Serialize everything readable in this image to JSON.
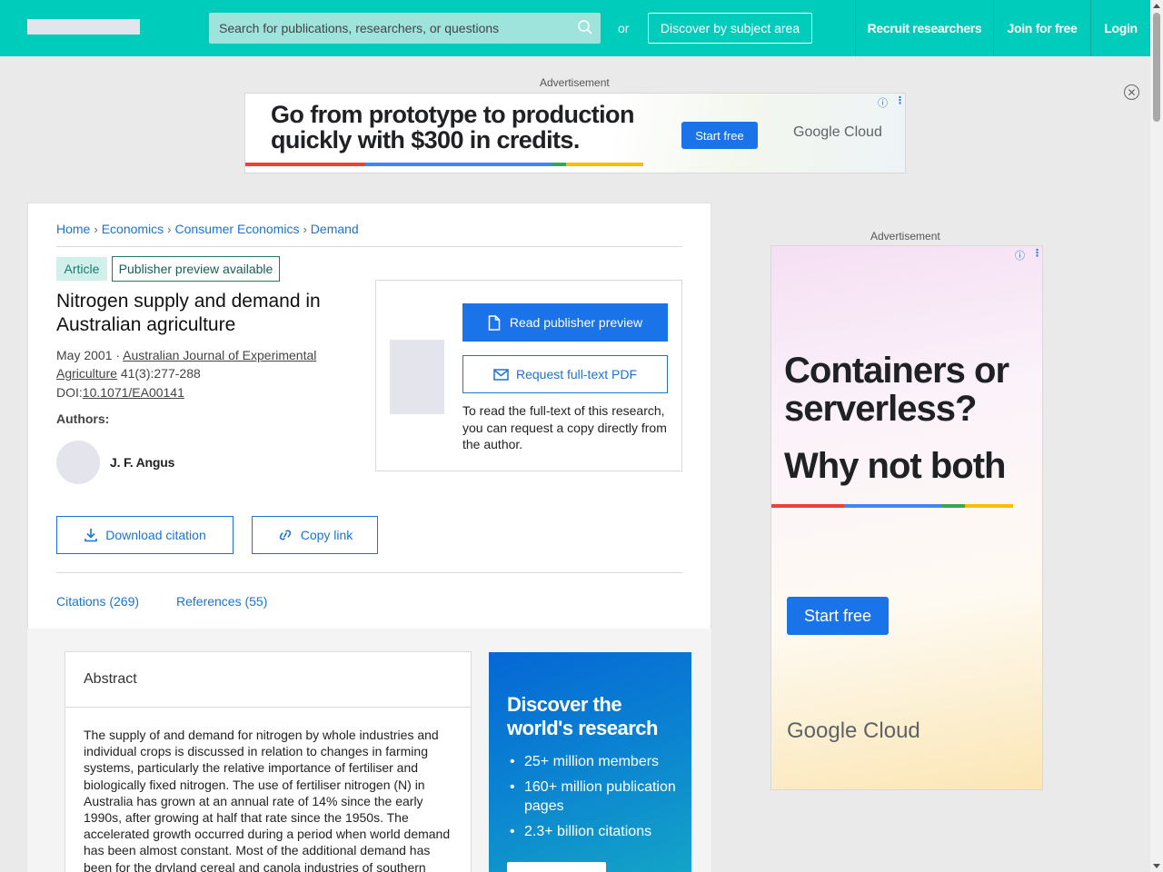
{
  "header": {
    "search_placeholder": "Search for publications, researchers, or questions",
    "or_text": "or",
    "discover_label": "Discover by subject area",
    "nav": [
      "Recruit researchers",
      "Join for free",
      "Login"
    ]
  },
  "top_ad": {
    "label": "Advertisement",
    "headline_line1": "Go from prototype to production",
    "headline_line2": "quickly with $300 in credits.",
    "cta": "Start free",
    "brand": "Google Cloud"
  },
  "side_ad": {
    "label": "Advertisement",
    "headline_line1": "Containers or",
    "headline_line2": "serverless?",
    "headline_line3": "Why not both",
    "cta": "Start free",
    "brand": "Google Cloud"
  },
  "breadcrumb": [
    "Home",
    "Economics",
    "Consumer Economics",
    "Demand"
  ],
  "article": {
    "type_badge": "Article",
    "preview_badge": "Publisher preview available",
    "title": "Nitrogen supply and demand in Australian agriculture",
    "date": "May 2001",
    "journal": "Australian Journal of Experimental Agriculture",
    "volume": "41(3):277-288",
    "doi_label": "DOI:",
    "doi": "10.1071/EA00141",
    "authors_label": "Authors:",
    "author": "J. F. Angus"
  },
  "actions": {
    "download_citation": "Download citation",
    "copy_link": "Copy link"
  },
  "tabs": [
    "Citations (269)",
    "References (55)"
  ],
  "preview_box": {
    "read_preview": "Read publisher preview",
    "request_pdf": "Request full-text PDF",
    "note": "To read the full-text of this research, you can request a copy directly from the author."
  },
  "abstract": {
    "heading": "Abstract",
    "text": "The supply of and demand for nitrogen by whole industries and individual crops is discussed in relation to changes in farming systems, particularly the relative importance of fertiliser and biologically fixed nitrogen. The use of fertiliser nitrogen (N) in Australia has grown at an annual rate of 14% since the early 1990s, after growing at half that rate since the 1950s. The accelerated growth occurred during a period when world demand has been almost constant. Most of the additional demand has been for the dryland cereal and canola industries of southern"
  },
  "promo": {
    "heading": "Discover the world's research",
    "bullets": [
      "25+ million members",
      "160+ million publication pages",
      "2.3+ billion citations"
    ]
  },
  "colors": {
    "header_bg": "#00ccbb",
    "link_blue": "#1a73d6",
    "button_blue": "#1a73e8",
    "badge_bg": "#d1f0ec"
  }
}
